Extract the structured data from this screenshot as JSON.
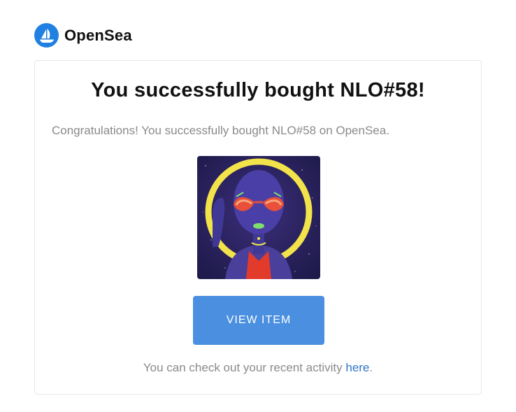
{
  "header": {
    "brand_name": "OpenSea",
    "logo_icon": "opensea-boat-icon",
    "brand_color": "#2081e2"
  },
  "email": {
    "title": "You successfully bought NLO#58!",
    "message": "Congratulations! You successfully bought NLO#58 on OpenSea.",
    "image_alt": "NLO#58",
    "button_label": "VIEW ITEM",
    "button_color": "#4a8fe0",
    "activity_text": "You can check out your recent activity ",
    "activity_link": "here",
    "activity_suffix": ".",
    "link_color": "#2e77c7"
  }
}
